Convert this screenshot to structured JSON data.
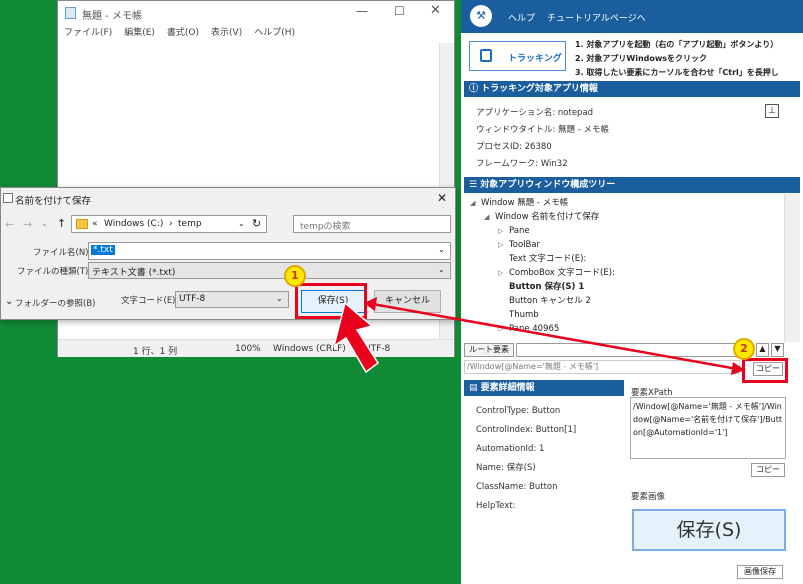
{
  "notepad": {
    "title": "無題 - メモ帳",
    "menu": [
      "ファイル(F)",
      "編集(E)",
      "書式(O)",
      "表示(V)",
      "ヘルプ(H)"
    ],
    "status": {
      "pos": "1 行、1 列",
      "zoom": "100%",
      "eol": "Windows (CRLF)",
      "enc": "UTF-8"
    }
  },
  "dialog": {
    "title": "名前を付けて保存",
    "path_prefix": "«",
    "path_drive": "Windows (C:)",
    "path_sep": "›",
    "path_folder": "temp",
    "search_placeholder": "tempの検索",
    "filename_label": "ファイル名(N):",
    "filename_value": "*.txt",
    "filetype_label": "ファイルの種類(T):",
    "filetype_value": "テキスト文書 (*.txt)",
    "browse_label": "フォルダーの参照(B)",
    "encoding_label": "文字コード(E):",
    "encoding_value": "UTF-8",
    "save": "保存(S)",
    "cancel": "キャンセル"
  },
  "panel": {
    "menu_help": "ヘルプ",
    "menu_tutorial": "チュートリアルページへ",
    "tracking_button": "トラッキング",
    "steps": [
      "1. 対象アプリを起動（右の「アプリ起動」ボタンより）",
      "2. 対象アプリWindowsをクリック",
      "3. 取得したい要素にカーソルを合わせ「Ctrl」を長押し"
    ],
    "app_info_header": "トラッキング対象アプリ情報",
    "app_info": [
      {
        "label": "アプリケーション名:",
        "value": "notepad"
      },
      {
        "label": "ウィンドウタイトル:",
        "value": "無題 - メモ帳"
      },
      {
        "label": "プロセスID:",
        "value": "26380"
      },
      {
        "label": "フレームワーク:",
        "value": "Win32"
      }
    ],
    "tree_header": "対象アプリウィンドウ構成ツリー",
    "tree": [
      {
        "arrow": "◢",
        "text": "Window 無題 - メモ帳",
        "bold": false,
        "indent": 0
      },
      {
        "arrow": "◢",
        "text": "Window 名前を付けて保存",
        "bold": false,
        "indent": 1
      },
      {
        "arrow": "▷",
        "text": "Pane",
        "bold": false,
        "indent": 2
      },
      {
        "arrow": "▷",
        "text": "ToolBar",
        "bold": false,
        "indent": 2
      },
      {
        "arrow": "",
        "text": "Text 文字コード(E):",
        "bold": false,
        "indent": 2
      },
      {
        "arrow": "▷",
        "text": "ComboBox 文字コード(E):",
        "bold": false,
        "indent": 2
      },
      {
        "arrow": "",
        "text": "Button 保存(S) 1",
        "bold": true,
        "indent": 2
      },
      {
        "arrow": "",
        "text": "Button キャンセル 2",
        "bold": false,
        "indent": 2
      },
      {
        "arrow": "",
        "text": "Thumb",
        "bold": false,
        "indent": 2
      },
      {
        "arrow": "▷",
        "text": "Pane 40965",
        "bold": false,
        "indent": 2
      }
    ],
    "root_button": "ルート要素",
    "xpath_short": "/Window[@Name='無題 - メモ帳']",
    "copy": "コピー",
    "detail_header": "要素詳細情報",
    "details": [
      {
        "label": "ControlType:",
        "value": "Button"
      },
      {
        "label": "ControlIndex:",
        "value": "Button[1]"
      },
      {
        "label": "AutomationId:",
        "value": "1"
      },
      {
        "label": "Name:",
        "value": "保存(S)"
      },
      {
        "label": "ClassName:",
        "value": "Button"
      },
      {
        "label": "HelpText:",
        "value": ""
      }
    ],
    "xpath_label": "要素XPath",
    "xpath_full": "/Window[@Name='無題 - メモ帳']/Window[@Name='名前を付けて保存']/Button[@AutomationId='1']",
    "image_label": "要素画像",
    "image_text": "保存(S)",
    "image_save": "画像保存"
  },
  "callouts": {
    "one": "1",
    "two": "2"
  }
}
